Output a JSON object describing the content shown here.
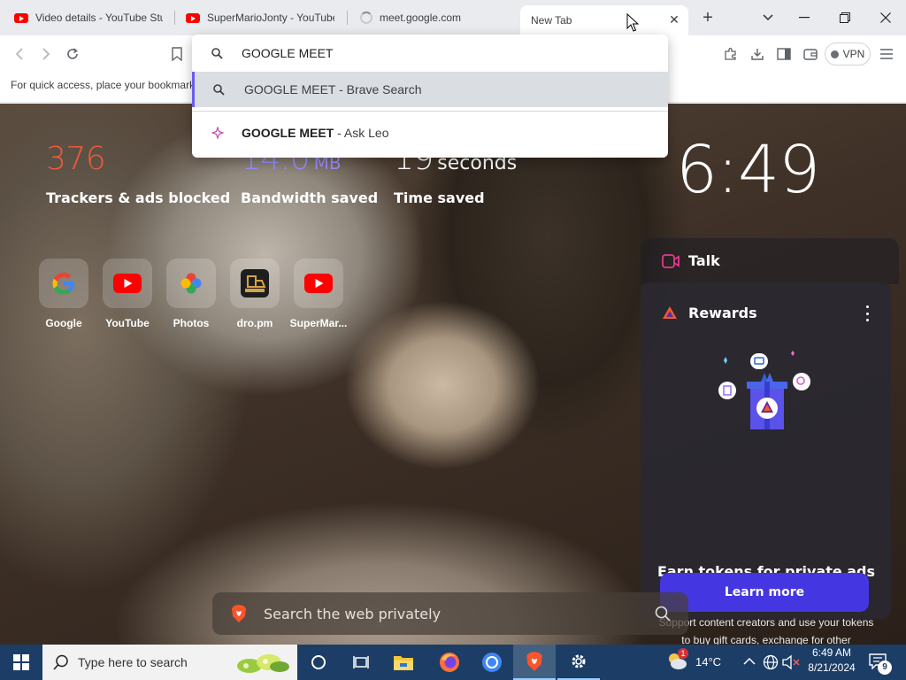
{
  "tabs": [
    {
      "title": "Video details - YouTube Stu",
      "icon": "youtube-favicon"
    },
    {
      "title": "SuperMarioJonty - YouTube",
      "icon": "youtube-favicon"
    },
    {
      "title": "meet.google.com",
      "icon": "loading-spinner"
    },
    {
      "title": "New Tab",
      "icon": "none",
      "active": true
    }
  ],
  "toolbar": {
    "vpn_label": "VPN"
  },
  "bookmarks_bar": {
    "hint": "For quick access, place your bookmarks here on the bookmarks bar."
  },
  "omnibox": {
    "value": "GOOGLE MEET",
    "suggestions": [
      {
        "query": "GOOGLE MEET",
        "suffix": " - Brave Search",
        "icon": "search-icon",
        "selected": true
      },
      {
        "query": "GOOGLE MEET",
        "suffix": " - Ask Leo",
        "icon": "leo-icon",
        "selected": false
      }
    ]
  },
  "stats": {
    "trackers": {
      "value": "376",
      "label": "Trackers & ads blocked",
      "color": "#f15a3a"
    },
    "bandwidth": {
      "value": "14.0",
      "unit": "MB",
      "label": "Bandwidth saved",
      "color": "#9b8cff"
    },
    "time": {
      "value": "19",
      "unit": "seconds",
      "label": "Time saved",
      "color": "#ffffff"
    }
  },
  "clock": "6:49",
  "top_sites": [
    {
      "label": "Google",
      "icon": "google-icon"
    },
    {
      "label": "YouTube",
      "icon": "youtube-icon"
    },
    {
      "label": "Photos",
      "icon": "photos-icon"
    },
    {
      "label": "dro.pm",
      "icon": "dropm-icon"
    },
    {
      "label": "SuperMar...",
      "icon": "youtube-icon"
    }
  ],
  "talk": {
    "label": "Talk"
  },
  "rewards": {
    "title": "Rewards",
    "headline": "Earn tokens for private ads you see in Brave",
    "body": "Support content creators and use your tokens to buy gift cards, exchange for other currencies, and more.",
    "button": "Learn more"
  },
  "search": {
    "placeholder": "Search the web privately"
  },
  "taskbar": {
    "search_placeholder": "Type here to search",
    "weather": "14°C",
    "weather_badge": "1",
    "time": "6:49 AM",
    "date": "8/21/2024",
    "notifications": "9"
  },
  "colors": {
    "brave_orange": "#fb542b",
    "rewards_button": "#4436e0",
    "taskbar": "#1c3d66"
  }
}
